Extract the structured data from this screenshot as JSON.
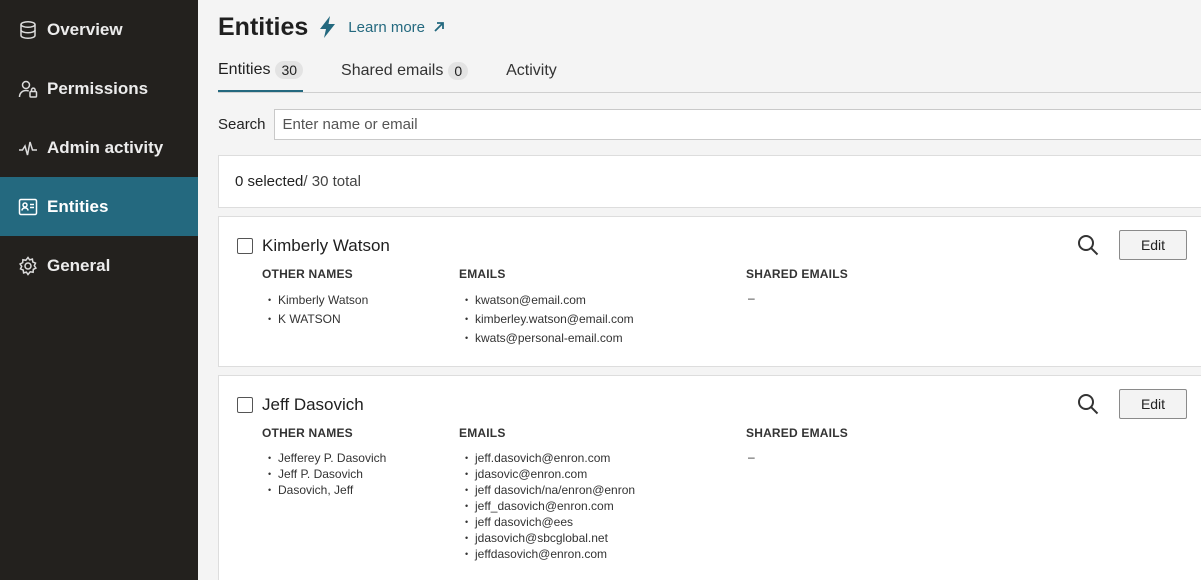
{
  "sidebar": {
    "items": [
      {
        "label": "Overview",
        "icon": "database-icon",
        "active": false
      },
      {
        "label": "Permissions",
        "icon": "user-lock-icon",
        "active": false
      },
      {
        "label": "Admin activity",
        "icon": "activity-icon",
        "active": false
      },
      {
        "label": "Entities",
        "icon": "id-card-icon",
        "active": true
      },
      {
        "label": "General",
        "icon": "gear-icon",
        "active": false
      }
    ]
  },
  "header": {
    "title": "Entities",
    "learn_more": "Learn more"
  },
  "tabs": [
    {
      "label": "Entities",
      "count": "30"
    },
    {
      "label": "Shared emails",
      "count": "0"
    },
    {
      "label": "Activity",
      "count": null
    }
  ],
  "search": {
    "label": "Search",
    "placeholder": "Enter name or email",
    "value": ""
  },
  "selection": {
    "selected": "0 selected",
    "total": " / 30 total"
  },
  "columns": {
    "other_names": "OTHER NAMES",
    "emails": "EMAILS",
    "shared_emails": "SHARED EMAILS"
  },
  "actions": {
    "edit_label": "Edit"
  },
  "entities": [
    {
      "name": "Kimberly Watson",
      "other_names": [
        "Kimberly Watson",
        "K WATSON"
      ],
      "emails": [
        "kwatson@email.com",
        "kimberley.watson@email.com",
        "kwats@personal-email.com"
      ],
      "shared_emails": "–"
    },
    {
      "name": "Jeff Dasovich",
      "other_names": [
        "Jefferey P. Dasovich",
        "Jeff P. Dasovich",
        "Dasovich, Jeff"
      ],
      "emails": [
        "jeff.dasovich@enron.com",
        "jdasovic@enron.com",
        "jeff dasovich/na/enron@enron",
        "jeff_dasovich@enron.com",
        "jeff dasovich@ees",
        "jdasovich@sbcglobal.net",
        "jeffdasovich@enron.com"
      ],
      "shared_emails": "–"
    }
  ],
  "colors": {
    "sidebar_bg": "#23211e",
    "accent": "#24697f"
  }
}
